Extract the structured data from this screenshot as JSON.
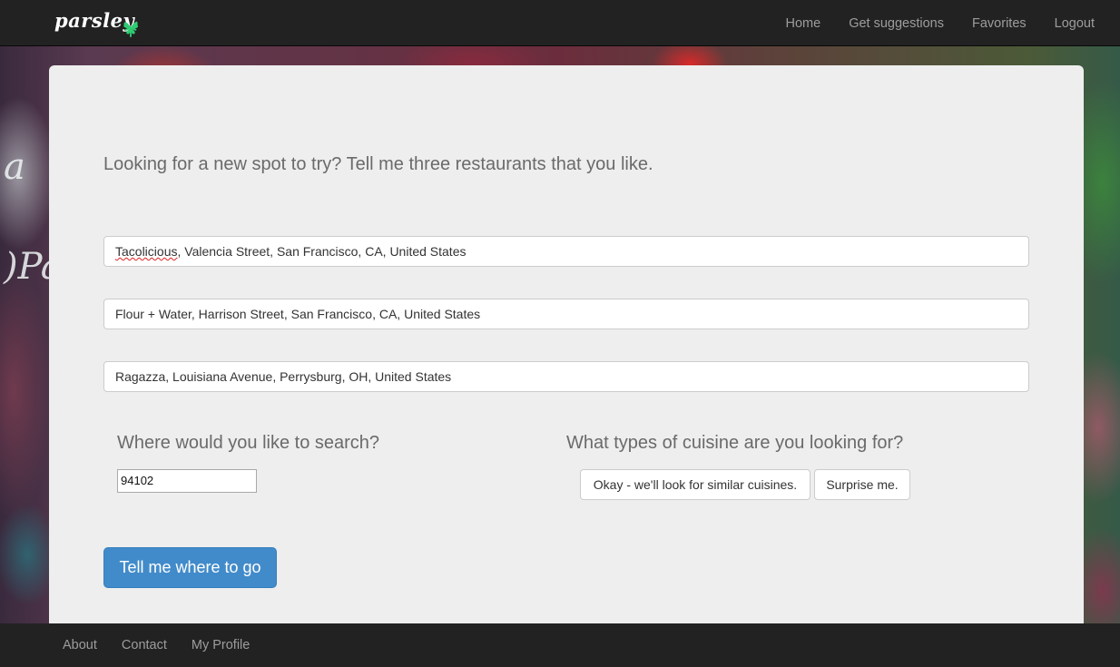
{
  "brand": {
    "name": "parsley",
    "logo_icon": "parsley-leaf-icon",
    "accent_color": "#2ecc71"
  },
  "nav": {
    "items": [
      {
        "label": "Home"
      },
      {
        "label": "Get suggestions"
      },
      {
        "label": "Favorites"
      },
      {
        "label": "Logout"
      }
    ]
  },
  "background": {
    "script_text": "a\n)Pa"
  },
  "form": {
    "headline": "Looking for a new spot to try? Tell me three restaurants that you like.",
    "restaurants": [
      {
        "name_part": "Tacolicious",
        "rest": ", Valencia Street, San Francisco, CA, United States"
      },
      {
        "value": "Flour + Water, Harrison Street, San Francisco, CA, United States"
      },
      {
        "value": "Ragazza, Louisiana Avenue, Perrysburg, OH, United States"
      }
    ],
    "location": {
      "label": "Where would you like to search?",
      "value": "94102"
    },
    "cuisine": {
      "label": "What types of cuisine are you looking for?",
      "options": [
        {
          "label": "Okay - we'll look for similar cuisines."
        },
        {
          "label": "Surprise me."
        }
      ]
    },
    "submit_label": "Tell me where to go"
  },
  "footer": {
    "items": [
      {
        "label": "About"
      },
      {
        "label": "Contact"
      },
      {
        "label": "My Profile"
      }
    ]
  },
  "colors": {
    "navbar": "#222222",
    "panel": "#eeeeee",
    "primary": "#428bca",
    "nav_text": "#9d9d9d"
  }
}
